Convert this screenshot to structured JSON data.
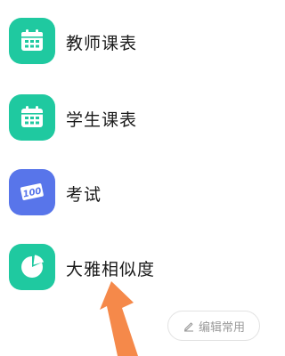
{
  "menu": {
    "items": [
      {
        "label": "教师课表",
        "icon": "calendar-icon",
        "color": "#1fc9a0"
      },
      {
        "label": "学生课表",
        "icon": "calendar-icon",
        "color": "#1fc9a0"
      },
      {
        "label": "考试",
        "icon": "score-100-icon",
        "color": "#5875ea"
      },
      {
        "label": "大雅相似度",
        "icon": "pie-chart-icon",
        "color": "#1fc9a0"
      }
    ]
  },
  "exam_icon_text": "100",
  "edit_button": {
    "label": "编辑常用",
    "icon": "pencil-icon"
  },
  "annotation": {
    "icon": "arrow-up-icon",
    "color": "#f5894a"
  }
}
